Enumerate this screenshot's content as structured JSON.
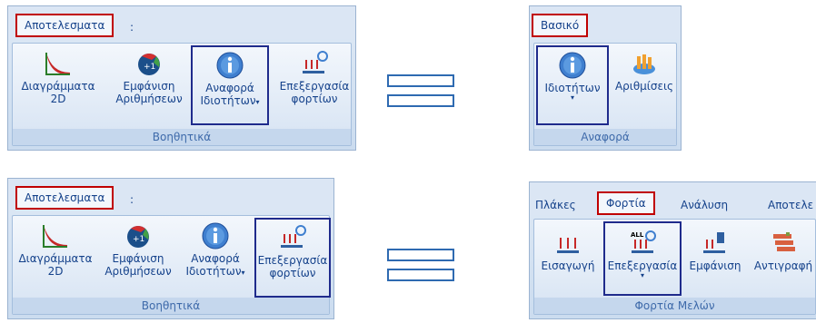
{
  "panel_tl": {
    "tab": "Αποτελεσματα",
    "tab_suffix": ":",
    "buttons": [
      {
        "line1": "Διαγράμματα",
        "line2": "2D"
      },
      {
        "line1": "Εμφάνιση",
        "line2": "Αριθμήσεων"
      },
      {
        "line1": "Αναφορά",
        "line2": "Ιδιοτήτων"
      },
      {
        "line1": "Επεξεργασία",
        "line2": "φορτίων"
      }
    ],
    "group": "Βοηθητικά"
  },
  "panel_tr": {
    "tab": "Βασικό",
    "buttons": [
      {
        "line1": "Ιδιοτήτων"
      },
      {
        "line1": "Αριθμίσεις"
      }
    ],
    "group": "Αναφορά"
  },
  "panel_bl": {
    "tab": "Αποτελεσματα",
    "tab_suffix": ":",
    "buttons": [
      {
        "line1": "Διαγράμματα",
        "line2": "2D"
      },
      {
        "line1": "Εμφάνιση",
        "line2": "Αριθμήσεων"
      },
      {
        "line1": "Αναφορά",
        "line2": "Ιδιοτήτων"
      },
      {
        "line1": "Επεξεργασία",
        "line2": "φορτίων"
      }
    ],
    "group": "Βοηθητικά"
  },
  "panel_br": {
    "tabs": [
      "Πλάκες",
      "Φορτία",
      "Ανάλυση",
      "Αποτελε"
    ],
    "buttons": [
      {
        "line1": "Εισαγωγή"
      },
      {
        "line1": "Επεξεργασία"
      },
      {
        "line1": "Εμφάνιση"
      },
      {
        "line1": "Αντιγραφή"
      }
    ],
    "all_badge": "ALL",
    "group": "Φορτία Μελών"
  },
  "colors": {
    "highlight_red": "#c00000",
    "highlight_navy": "#1f2b8c",
    "equals": "#2e6ab1"
  }
}
